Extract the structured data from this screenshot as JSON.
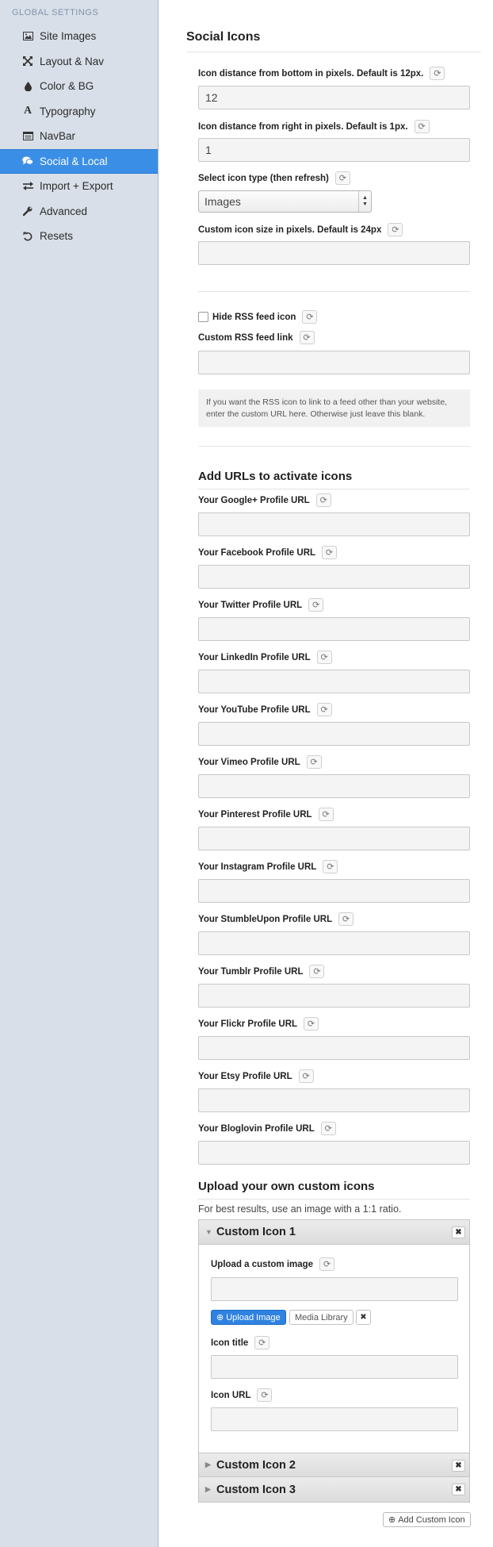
{
  "sidebar": {
    "heading": "GLOBAL SETTINGS",
    "items": [
      {
        "label": "Site Images",
        "icon": "image-icon"
      },
      {
        "label": "Layout & Nav",
        "icon": "arrows-icon"
      },
      {
        "label": "Color & BG",
        "icon": "droplet-icon"
      },
      {
        "label": "Typography",
        "icon": "font-icon"
      },
      {
        "label": "NavBar",
        "icon": "list-icon"
      },
      {
        "label": "Social & Local",
        "icon": "comments-icon",
        "active": true
      },
      {
        "label": "Import + Export",
        "icon": "exchange-icon"
      },
      {
        "label": "Advanced",
        "icon": "wrench-icon"
      },
      {
        "label": "Resets",
        "icon": "undo-icon"
      }
    ]
  },
  "main": {
    "title": "Social Icons",
    "distance_bottom": {
      "label": "Icon distance from bottom in pixels. Default is 12px.",
      "value": "12"
    },
    "distance_right": {
      "label": "Icon distance from right in pixels. Default is 1px.",
      "value": "1"
    },
    "icon_type": {
      "label": "Select icon type (then refresh)",
      "value": "Images"
    },
    "icon_size": {
      "label": "Custom icon size in pixels. Default is 24px",
      "value": ""
    },
    "hide_rss": {
      "label": "Hide RSS feed icon",
      "checked": false
    },
    "rss_link": {
      "label": "Custom RSS feed link",
      "value": ""
    },
    "rss_help": "If you want the RSS icon to link to a feed other than your website, enter the custom URL here. Otherwise just leave this blank.",
    "urls_title": "Add URLs to activate icons",
    "profiles": [
      {
        "label": "Your Google+ Profile URL",
        "value": ""
      },
      {
        "label": "Your Facebook Profile URL",
        "value": ""
      },
      {
        "label": "Your Twitter Profile URL",
        "value": ""
      },
      {
        "label": "Your LinkedIn Profile URL",
        "value": ""
      },
      {
        "label": "Your YouTube Profile URL",
        "value": ""
      },
      {
        "label": "Your Vimeo Profile URL",
        "value": ""
      },
      {
        "label": "Your Pinterest Profile URL",
        "value": ""
      },
      {
        "label": "Your Instagram Profile URL",
        "value": ""
      },
      {
        "label": "Your StumbleUpon Profile URL",
        "value": ""
      },
      {
        "label": "Your Tumblr Profile URL",
        "value": ""
      },
      {
        "label": "Your Flickr Profile URL",
        "value": ""
      },
      {
        "label": "Your Etsy Profile URL",
        "value": ""
      },
      {
        "label": "Your Bloglovin Profile URL",
        "value": ""
      }
    ],
    "upload_title": "Upload your own custom icons",
    "upload_note": "For best results, use an image with a 1:1 ratio.",
    "custom_icons": [
      {
        "title": "Custom Icon 1",
        "expanded": true
      },
      {
        "title": "Custom Icon 2",
        "expanded": false
      },
      {
        "title": "Custom Icon 3",
        "expanded": false
      }
    ],
    "custom_fields": {
      "upload_label": "Upload a custom image",
      "upload_button": "Upload Image",
      "media_button": "Media Library",
      "title_label": "Icon title",
      "url_label": "Icon URL"
    },
    "add_button": "Add Custom Icon"
  }
}
